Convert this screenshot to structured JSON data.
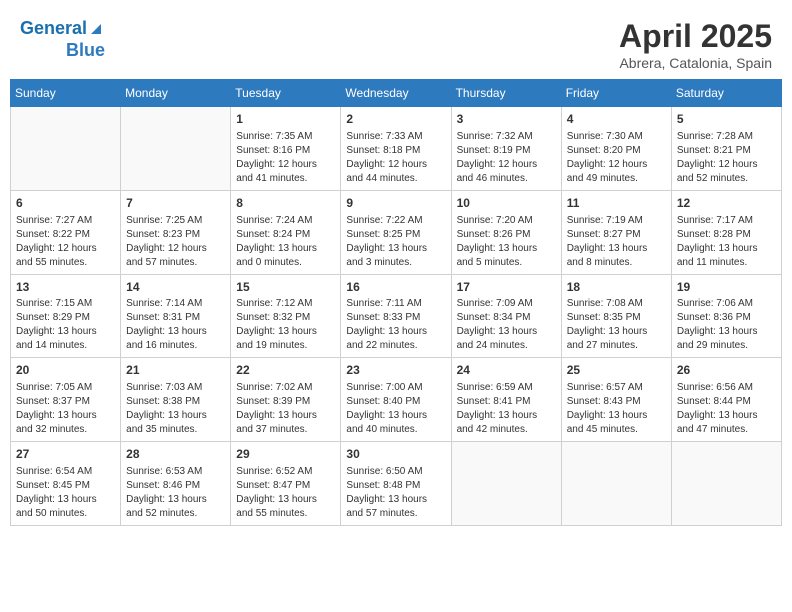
{
  "header": {
    "logo_line1": "General",
    "logo_line2": "Blue",
    "month": "April 2025",
    "location": "Abrera, Catalonia, Spain"
  },
  "weekdays": [
    "Sunday",
    "Monday",
    "Tuesday",
    "Wednesday",
    "Thursday",
    "Friday",
    "Saturday"
  ],
  "weeks": [
    [
      {
        "day": "",
        "sunrise": "",
        "sunset": "",
        "daylight": ""
      },
      {
        "day": "",
        "sunrise": "",
        "sunset": "",
        "daylight": ""
      },
      {
        "day": "1",
        "sunrise": "Sunrise: 7:35 AM",
        "sunset": "Sunset: 8:16 PM",
        "daylight": "Daylight: 12 hours and 41 minutes."
      },
      {
        "day": "2",
        "sunrise": "Sunrise: 7:33 AM",
        "sunset": "Sunset: 8:18 PM",
        "daylight": "Daylight: 12 hours and 44 minutes."
      },
      {
        "day": "3",
        "sunrise": "Sunrise: 7:32 AM",
        "sunset": "Sunset: 8:19 PM",
        "daylight": "Daylight: 12 hours and 46 minutes."
      },
      {
        "day": "4",
        "sunrise": "Sunrise: 7:30 AM",
        "sunset": "Sunset: 8:20 PM",
        "daylight": "Daylight: 12 hours and 49 minutes."
      },
      {
        "day": "5",
        "sunrise": "Sunrise: 7:28 AM",
        "sunset": "Sunset: 8:21 PM",
        "daylight": "Daylight: 12 hours and 52 minutes."
      }
    ],
    [
      {
        "day": "6",
        "sunrise": "Sunrise: 7:27 AM",
        "sunset": "Sunset: 8:22 PM",
        "daylight": "Daylight: 12 hours and 55 minutes."
      },
      {
        "day": "7",
        "sunrise": "Sunrise: 7:25 AM",
        "sunset": "Sunset: 8:23 PM",
        "daylight": "Daylight: 12 hours and 57 minutes."
      },
      {
        "day": "8",
        "sunrise": "Sunrise: 7:24 AM",
        "sunset": "Sunset: 8:24 PM",
        "daylight": "Daylight: 13 hours and 0 minutes."
      },
      {
        "day": "9",
        "sunrise": "Sunrise: 7:22 AM",
        "sunset": "Sunset: 8:25 PM",
        "daylight": "Daylight: 13 hours and 3 minutes."
      },
      {
        "day": "10",
        "sunrise": "Sunrise: 7:20 AM",
        "sunset": "Sunset: 8:26 PM",
        "daylight": "Daylight: 13 hours and 5 minutes."
      },
      {
        "day": "11",
        "sunrise": "Sunrise: 7:19 AM",
        "sunset": "Sunset: 8:27 PM",
        "daylight": "Daylight: 13 hours and 8 minutes."
      },
      {
        "day": "12",
        "sunrise": "Sunrise: 7:17 AM",
        "sunset": "Sunset: 8:28 PM",
        "daylight": "Daylight: 13 hours and 11 minutes."
      }
    ],
    [
      {
        "day": "13",
        "sunrise": "Sunrise: 7:15 AM",
        "sunset": "Sunset: 8:29 PM",
        "daylight": "Daylight: 13 hours and 14 minutes."
      },
      {
        "day": "14",
        "sunrise": "Sunrise: 7:14 AM",
        "sunset": "Sunset: 8:31 PM",
        "daylight": "Daylight: 13 hours and 16 minutes."
      },
      {
        "day": "15",
        "sunrise": "Sunrise: 7:12 AM",
        "sunset": "Sunset: 8:32 PM",
        "daylight": "Daylight: 13 hours and 19 minutes."
      },
      {
        "day": "16",
        "sunrise": "Sunrise: 7:11 AM",
        "sunset": "Sunset: 8:33 PM",
        "daylight": "Daylight: 13 hours and 22 minutes."
      },
      {
        "day": "17",
        "sunrise": "Sunrise: 7:09 AM",
        "sunset": "Sunset: 8:34 PM",
        "daylight": "Daylight: 13 hours and 24 minutes."
      },
      {
        "day": "18",
        "sunrise": "Sunrise: 7:08 AM",
        "sunset": "Sunset: 8:35 PM",
        "daylight": "Daylight: 13 hours and 27 minutes."
      },
      {
        "day": "19",
        "sunrise": "Sunrise: 7:06 AM",
        "sunset": "Sunset: 8:36 PM",
        "daylight": "Daylight: 13 hours and 29 minutes."
      }
    ],
    [
      {
        "day": "20",
        "sunrise": "Sunrise: 7:05 AM",
        "sunset": "Sunset: 8:37 PM",
        "daylight": "Daylight: 13 hours and 32 minutes."
      },
      {
        "day": "21",
        "sunrise": "Sunrise: 7:03 AM",
        "sunset": "Sunset: 8:38 PM",
        "daylight": "Daylight: 13 hours and 35 minutes."
      },
      {
        "day": "22",
        "sunrise": "Sunrise: 7:02 AM",
        "sunset": "Sunset: 8:39 PM",
        "daylight": "Daylight: 13 hours and 37 minutes."
      },
      {
        "day": "23",
        "sunrise": "Sunrise: 7:00 AM",
        "sunset": "Sunset: 8:40 PM",
        "daylight": "Daylight: 13 hours and 40 minutes."
      },
      {
        "day": "24",
        "sunrise": "Sunrise: 6:59 AM",
        "sunset": "Sunset: 8:41 PM",
        "daylight": "Daylight: 13 hours and 42 minutes."
      },
      {
        "day": "25",
        "sunrise": "Sunrise: 6:57 AM",
        "sunset": "Sunset: 8:43 PM",
        "daylight": "Daylight: 13 hours and 45 minutes."
      },
      {
        "day": "26",
        "sunrise": "Sunrise: 6:56 AM",
        "sunset": "Sunset: 8:44 PM",
        "daylight": "Daylight: 13 hours and 47 minutes."
      }
    ],
    [
      {
        "day": "27",
        "sunrise": "Sunrise: 6:54 AM",
        "sunset": "Sunset: 8:45 PM",
        "daylight": "Daylight: 13 hours and 50 minutes."
      },
      {
        "day": "28",
        "sunrise": "Sunrise: 6:53 AM",
        "sunset": "Sunset: 8:46 PM",
        "daylight": "Daylight: 13 hours and 52 minutes."
      },
      {
        "day": "29",
        "sunrise": "Sunrise: 6:52 AM",
        "sunset": "Sunset: 8:47 PM",
        "daylight": "Daylight: 13 hours and 55 minutes."
      },
      {
        "day": "30",
        "sunrise": "Sunrise: 6:50 AM",
        "sunset": "Sunset: 8:48 PM",
        "daylight": "Daylight: 13 hours and 57 minutes."
      },
      {
        "day": "",
        "sunrise": "",
        "sunset": "",
        "daylight": ""
      },
      {
        "day": "",
        "sunrise": "",
        "sunset": "",
        "daylight": ""
      },
      {
        "day": "",
        "sunrise": "",
        "sunset": "",
        "daylight": ""
      }
    ]
  ]
}
